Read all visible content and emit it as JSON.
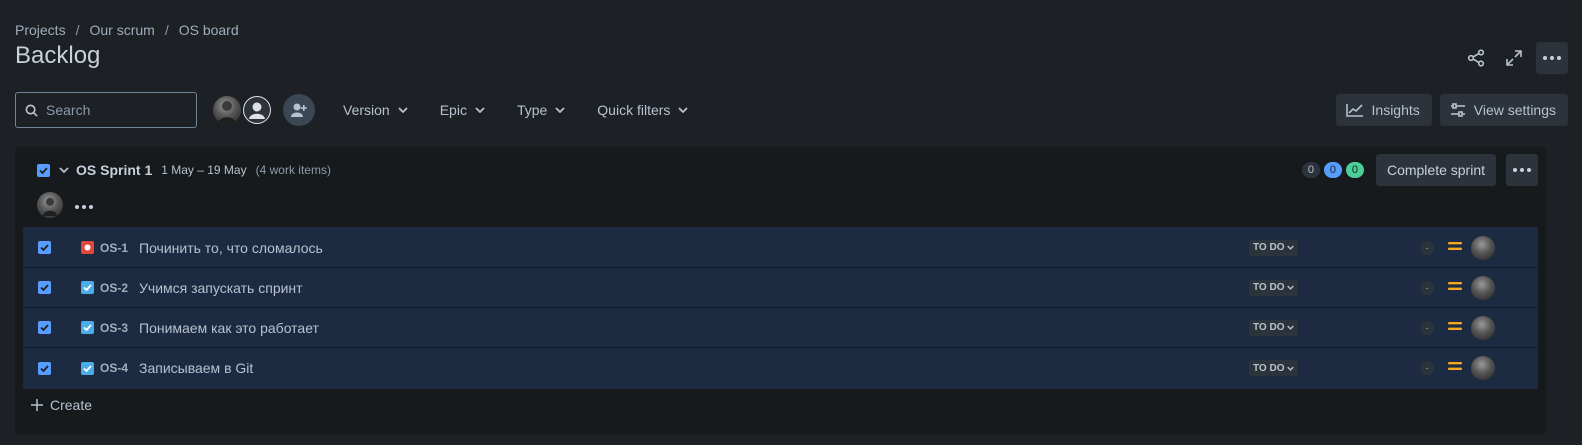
{
  "breadcrumb": [
    "Projects",
    "Our scrum",
    "OS board"
  ],
  "page_title": "Backlog",
  "search": {
    "placeholder": "Search",
    "value": ""
  },
  "filters": [
    "Version",
    "Epic",
    "Type",
    "Quick filters"
  ],
  "toolbar_right": {
    "insights": "Insights",
    "view_settings": "View settings"
  },
  "sprint": {
    "name": "OS Sprint 1",
    "dates": "1 May – 19 May",
    "count": "(4 work items)",
    "badges": {
      "todo": "0",
      "in_progress": "0",
      "done": "0"
    },
    "complete_label": "Complete sprint"
  },
  "issues": [
    {
      "key": "OS-1",
      "type": "bug",
      "summary": "Починить то, что сломалось",
      "status": "TO DO",
      "estimate": "-"
    },
    {
      "key": "OS-2",
      "type": "task",
      "summary": "Учимся запускать спринт",
      "status": "TO DO",
      "estimate": "-"
    },
    {
      "key": "OS-3",
      "type": "task",
      "summary": "Понимаем как это работает",
      "status": "TO DO",
      "estimate": "-"
    },
    {
      "key": "OS-4",
      "type": "task",
      "summary": "Записываем в Git",
      "status": "TO DO",
      "estimate": "-"
    }
  ],
  "create_label": "Create",
  "colors": {
    "accent": "#579dff",
    "bug": "#e2483d",
    "task": "#4bade8",
    "priority_medium": "#f5a623",
    "done": "#4bce97"
  }
}
